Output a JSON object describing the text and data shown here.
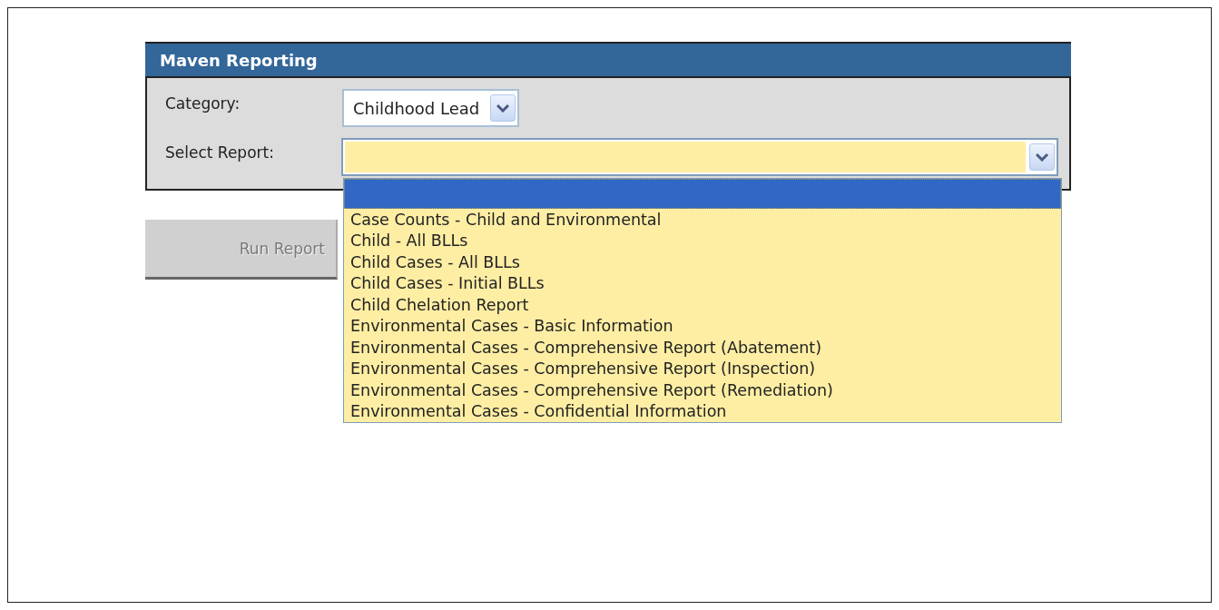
{
  "panel": {
    "title": "Maven Reporting"
  },
  "category": {
    "label": "Category:",
    "value": "Childhood Lead"
  },
  "report": {
    "label": "Select Report:",
    "expanded": true,
    "options": [
      {
        "selected": true
      },
      {
        "label": "Case Counts - Child and Environmental",
        "selected": false
      },
      {
        "label": "Child - All BLLs",
        "selected": false
      },
      {
        "label": "Child Cases - All BLLs",
        "selected": false
      },
      {
        "label": "Child Cases - Initial BLLs",
        "selected": false
      },
      {
        "label": "Child Chelation Report",
        "selected": false
      },
      {
        "label": "Environmental Cases - Basic Information",
        "selected": false
      },
      {
        "label": "Environmental Cases - Comprehensive Report (Abatement)",
        "selected": false
      },
      {
        "label": "Environmental Cases - Comprehensive Report (Inspection)",
        "selected": false
      },
      {
        "label": "Environmental Cases - Comprehensive Report (Remediation)",
        "selected": false
      },
      {
        "label": "Environmental Cases - Confidential Information",
        "selected": false
      }
    ]
  },
  "run_button": {
    "label": "Run Report",
    "disabled": true
  }
}
